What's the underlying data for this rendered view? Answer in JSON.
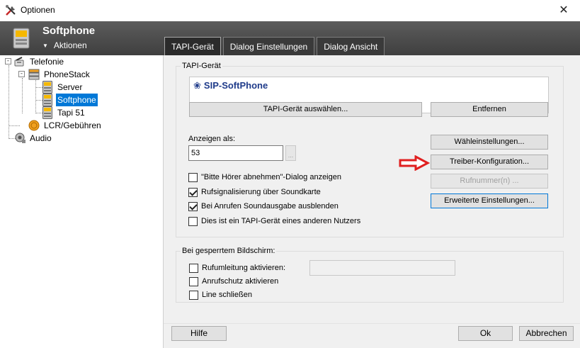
{
  "window": {
    "title": "Optionen",
    "close_glyph": "✕",
    "app_icon": "tools-icon"
  },
  "header": {
    "title": "Softphone",
    "actions_label": "Aktionen",
    "actions_glyph": "▼",
    "icon": "phone-device-icon"
  },
  "tabs": [
    {
      "label": "TAPI-Gerät",
      "active": true
    },
    {
      "label": "Dialog Einstellungen",
      "active": false
    },
    {
      "label": "Dialog Ansicht",
      "active": false
    }
  ],
  "tree": {
    "expand_glyph": "-",
    "items": [
      {
        "label": "Telefonie",
        "icon": "telephony-icon"
      },
      {
        "label": "PhoneStack",
        "icon": "phonestack-icon"
      },
      {
        "label": "Server",
        "icon": "phone-device-icon"
      },
      {
        "label": "Softphone",
        "icon": "phone-device-icon",
        "selected": true
      },
      {
        "label": "Tapi 51",
        "icon": "phone-device-icon"
      },
      {
        "label": "LCR/Gebühren",
        "icon": "coin-icon"
      },
      {
        "label": "Audio",
        "icon": "speaker-icon"
      }
    ]
  },
  "tapi_group": {
    "title": "TAPI-Gerät",
    "device_name": "SIP-SoftPhone",
    "device_icon": "handset-icon",
    "select_button": "TAPI-Gerät auswählen...",
    "remove_button": "Entfernen",
    "display_as_label": "Anzeigen als:",
    "display_as_value": "53",
    "ellipsis_glyph": "...",
    "dial_settings_button": "Wähleinstellungen...",
    "driver_config_button": "Treiber-Konfiguration...",
    "numbers_button": "Rufnummer(n) ...",
    "advanced_button": "Erweiterte Einstellungen...",
    "checkboxes": [
      {
        "label": "\"Bitte Hörer abnehmen\"-Dialog anzeigen",
        "checked": false
      },
      {
        "label": "Rufsignalisierung über Soundkarte",
        "checked": true
      },
      {
        "label": "Bei Anrufen Soundausgabe ausblenden",
        "checked": true
      },
      {
        "label": "Dies ist ein TAPI-Gerät eines anderen Nutzers",
        "checked": false
      }
    ]
  },
  "lock_group": {
    "title": "Bei gesperrtem Bildschirm:",
    "forwarding_label": "Rufumleitung aktivieren:",
    "forwarding_value": "",
    "dnd_label": "Anrufschutz aktivieren",
    "close_line_label": "Line schließen"
  },
  "footer": {
    "help_button": "Hilfe",
    "ok_button": "Ok",
    "cancel_button": "Abbrechen"
  },
  "colors": {
    "header_bg": "#4a4a4a",
    "selection": "#0078d7",
    "device_name": "#1f3b8a",
    "arrow": "#e02020"
  }
}
